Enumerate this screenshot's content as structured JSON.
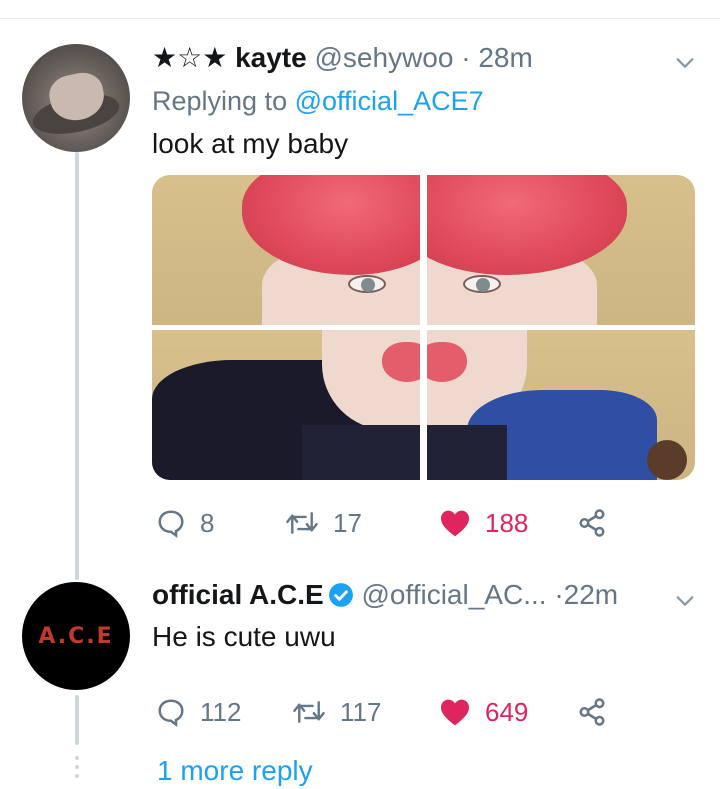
{
  "tweets": [
    {
      "stars": "★☆★",
      "name": "kayte",
      "handle": "@sehywoo",
      "separator": "·",
      "time": "28m",
      "replying_prefix": "Replying to",
      "replying_mention": "@official_ACE7",
      "text": "look at my baby",
      "has_photo_grid": true,
      "stats": {
        "replies": "8",
        "retweets": "17",
        "likes": "188"
      },
      "liked": true
    },
    {
      "name": "official A.C.E",
      "verified": true,
      "handle": "@official_AC...",
      "separator": "·",
      "time": "22m",
      "text": "He is cute uwu",
      "avatar_logo": "A.C.E",
      "stats": {
        "replies": "112",
        "retweets": "117",
        "likes": "649"
      },
      "liked": true
    }
  ],
  "more_reply_link": "1 more reply",
  "icons": {
    "reply": "reply-icon",
    "retweet": "retweet-icon",
    "like": "heart-icon",
    "share": "share-icon",
    "menu": "chevron-down-icon",
    "verified": "verified-badge-icon"
  },
  "colors": {
    "accent": "#1da1f2",
    "like": "#e0245e",
    "muted": "#657786",
    "thread": "#ccd6dd"
  }
}
